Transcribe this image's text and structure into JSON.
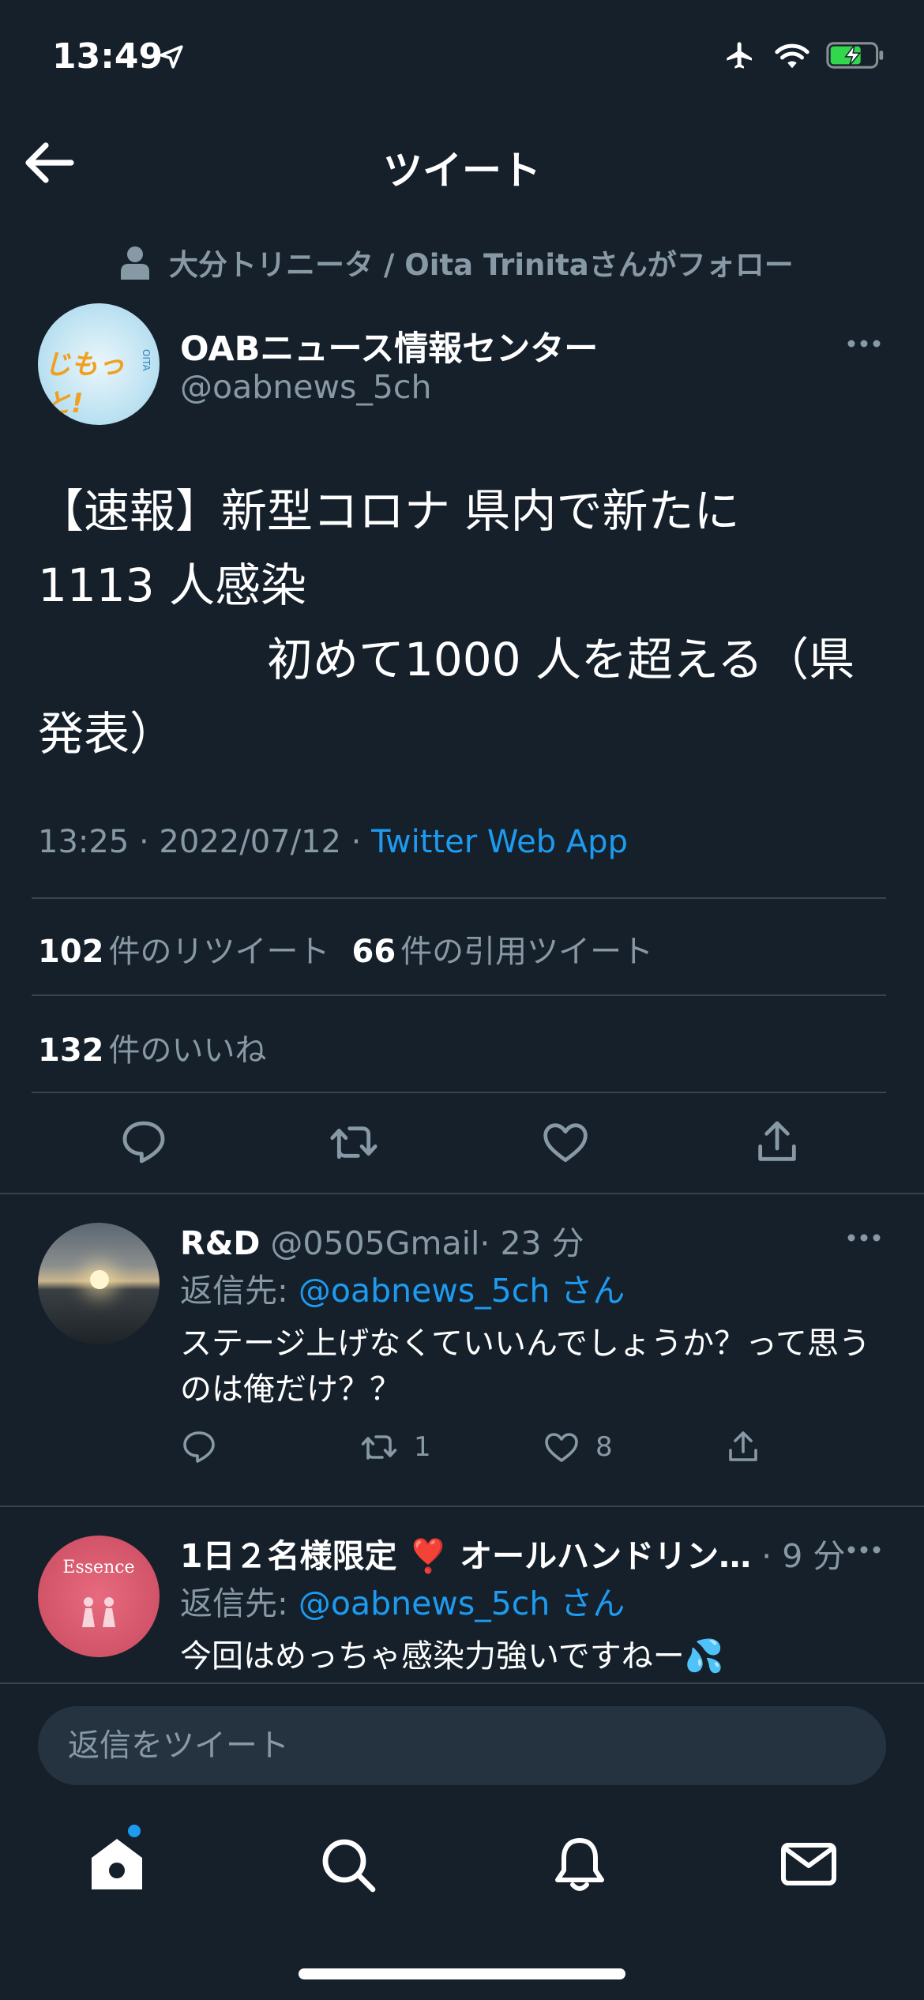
{
  "status_bar": {
    "time": "13:49"
  },
  "header": {
    "title": "ツイート"
  },
  "social_context": {
    "text": "大分トリニータ / Oita Trinitaさんがフォロー"
  },
  "author": {
    "name": "OABニュース情報センター",
    "handle": "@oabnews_5ch",
    "avatar_text": "じもっと!",
    "avatar_small_text": "OITA"
  },
  "tweet": {
    "text": "【速報】新型コロナ 県内で新たに\n1113 人感染\n　　　　　初めて1000 人を超える（県\n発表）",
    "timestamp": "13:25 · 2022/07/12 · ",
    "source": "Twitter Web App",
    "retweets_count": "102",
    "retweets_label": "件のリツイート",
    "quotes_count": "66",
    "quotes_label": "件の引用ツイート",
    "likes_count": "132",
    "likes_label": "件のいいね"
  },
  "replies": [
    {
      "name": "R&D",
      "handle": "@0505Gmail",
      "time": "· 23 分",
      "reply_to_label": "返信先: ",
      "reply_to_handle": "@oabnews_5ch さん",
      "text": "ステージ上げなくていいんでしょうか？って思うのは俺だけ？？",
      "retweets": "1",
      "likes": "8"
    },
    {
      "name": "1日２名様限定 ❣️ オールハンドリン…",
      "handle": "",
      "time": "· 9 分",
      "reply_to_label": "返信先: ",
      "reply_to_handle": "@oabnews_5ch さん",
      "text": "今回はめっちゃ感染力強いですねー💦",
      "avatar_text": "Essence"
    }
  ],
  "composer": {
    "placeholder": "返信をツイート"
  },
  "colors": {
    "background": "#15202b",
    "accent": "#1d9bf0",
    "muted": "#8899a6",
    "divider": "#38444d"
  },
  "icons": {
    "status": [
      "location-arrow-icon",
      "airplane-icon",
      "wifi-icon",
      "battery-charging-icon"
    ],
    "actions": [
      "reply-icon",
      "retweet-icon",
      "like-icon",
      "share-icon"
    ],
    "nav": [
      "home-icon",
      "search-icon",
      "notifications-icon",
      "messages-icon"
    ]
  }
}
